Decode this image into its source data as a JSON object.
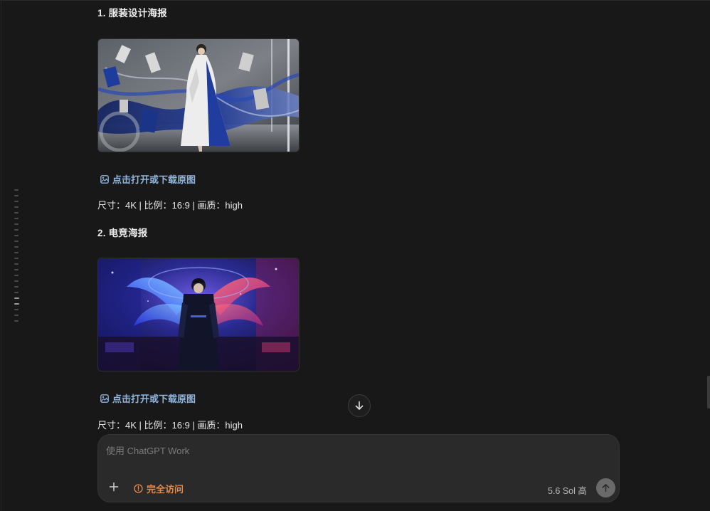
{
  "sections": [
    {
      "heading": "1. 服装设计海报",
      "link_label": "点击打开或下载原图",
      "meta": "尺寸：4K | 比例：16:9 | 画质：high"
    },
    {
      "heading": "2. 电竞海报",
      "link_label": "点击打开或下载原图",
      "meta": "尺寸：4K | 比例：16:9 | 画质：high"
    }
  ],
  "composer": {
    "placeholder": "使用 ChatGPT Work",
    "access_label": "完全访问",
    "model_label": "5.6 Sol 高"
  },
  "icons": {
    "image_link": "image-icon",
    "scroll_down": "arrow-down-icon",
    "add": "plus-icon",
    "warning": "alert-circle-icon",
    "send": "arrow-up-icon"
  },
  "colors": {
    "background": "#181818",
    "link": "#8fb4e0",
    "access": "#e4894a",
    "composer": "#2a2a2a"
  }
}
